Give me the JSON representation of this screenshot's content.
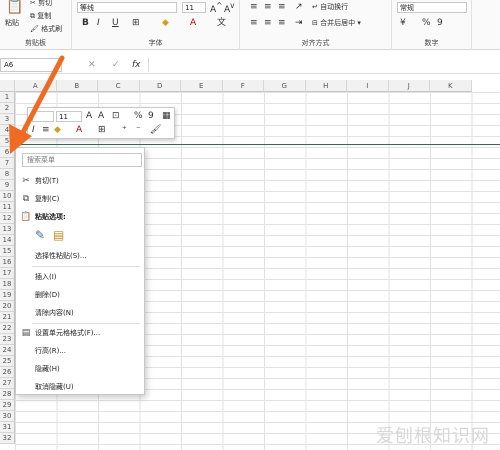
{
  "ribbon": {
    "clipboard": {
      "paste_label": "粘贴",
      "cut_label": "剪切",
      "copy_label": "复制",
      "format_painter_label": "格式刷",
      "group_label": "剪贴板"
    },
    "font": {
      "font_name": "等线",
      "font_size": "11",
      "group_label": "字体"
    },
    "alignment": {
      "wrap_text_label": "自动换行",
      "merge_label": "合并后居中",
      "group_label": "对齐方式"
    },
    "number": {
      "format": "常规",
      "group_label": "数字"
    }
  },
  "formula_bar": {
    "name_box": "A6",
    "fx_label": "fx"
  },
  "columns": [
    "A",
    "B",
    "C",
    "D",
    "E",
    "F",
    "G",
    "H",
    "I",
    "J",
    "K"
  ],
  "rows": [
    "1",
    "2",
    "3",
    "4",
    "5",
    "6",
    "7",
    "8",
    "9",
    "10",
    "11",
    "12",
    "13",
    "14",
    "15",
    "16",
    "17",
    "18",
    "19",
    "20",
    "21",
    "22",
    "23",
    "24",
    "25",
    "26",
    "27",
    "28",
    "29",
    "30",
    "31",
    "32"
  ],
  "mini_toolbar": {
    "font_name": "",
    "font_size": "11"
  },
  "context_menu": {
    "search_placeholder": "搜索菜单",
    "cut": "剪切(T)",
    "copy": "复制(C)",
    "paste_options": "粘贴选项:",
    "paste_special": "选择性粘贴(S)...",
    "insert": "插入(I)",
    "delete": "删除(D)",
    "clear_contents": "清除内容(N)",
    "format_cells": "设置单元格格式(F)...",
    "row_height": "行高(R)...",
    "hide": "隐藏(H)",
    "unhide": "取消隐藏(U)"
  },
  "watermark": "爱刨根知识网"
}
